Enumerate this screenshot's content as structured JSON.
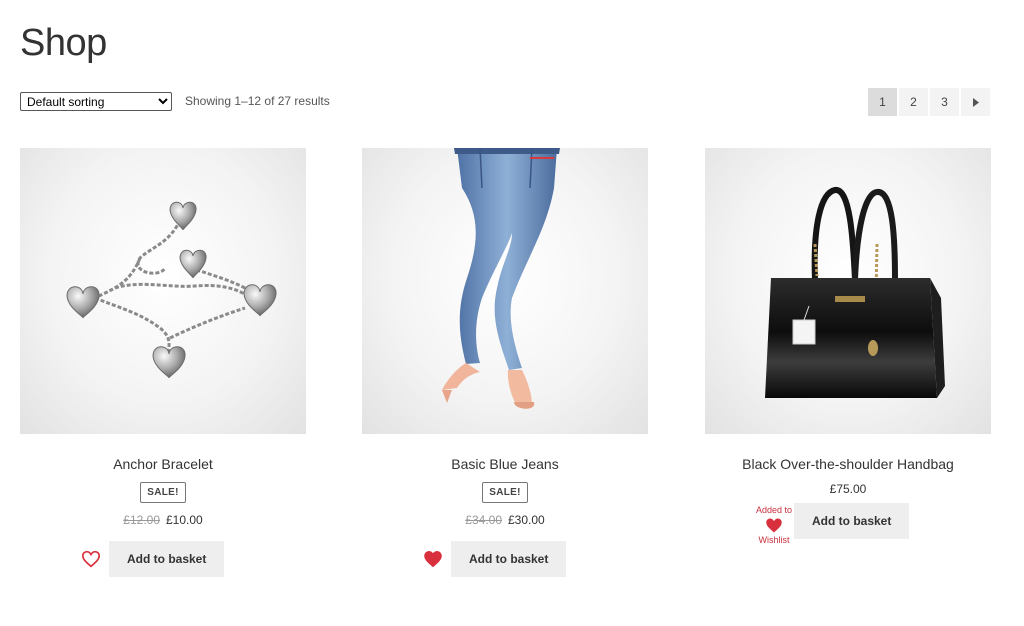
{
  "page": {
    "title": "Shop"
  },
  "toolbar": {
    "sorting": {
      "selected": "Default sorting"
    },
    "result_count": "Showing 1–12 of 27 results",
    "pagination": {
      "pages": [
        "1",
        "2",
        "3"
      ],
      "current": "1",
      "next_icon": "triangle-right-icon"
    }
  },
  "colors": {
    "wishlist_red": "#d8303d",
    "button_bg": "#eeeeee",
    "accent_text": "#c8303b"
  },
  "products": [
    {
      "title": "Anchor Bracelet",
      "sale_badge": "SALE!",
      "old_price": "£12.00",
      "price": "£10.00",
      "add_label": "Add to basket",
      "wishlist_state": "outline-heart-icon"
    },
    {
      "title": "Basic Blue Jeans",
      "sale_badge": "SALE!",
      "old_price": "£34.00",
      "price": "£30.00",
      "add_label": "Add to basket",
      "wishlist_state": "filled-heart-icon"
    },
    {
      "title": "Black Over-the-shoulder Handbag",
      "price": "£75.00",
      "add_label": "Add to basket",
      "wishlist_state": "filled-heart-icon",
      "wishlist_added_top": "Added to",
      "wishlist_added_bottom": "Wishlist"
    }
  ]
}
